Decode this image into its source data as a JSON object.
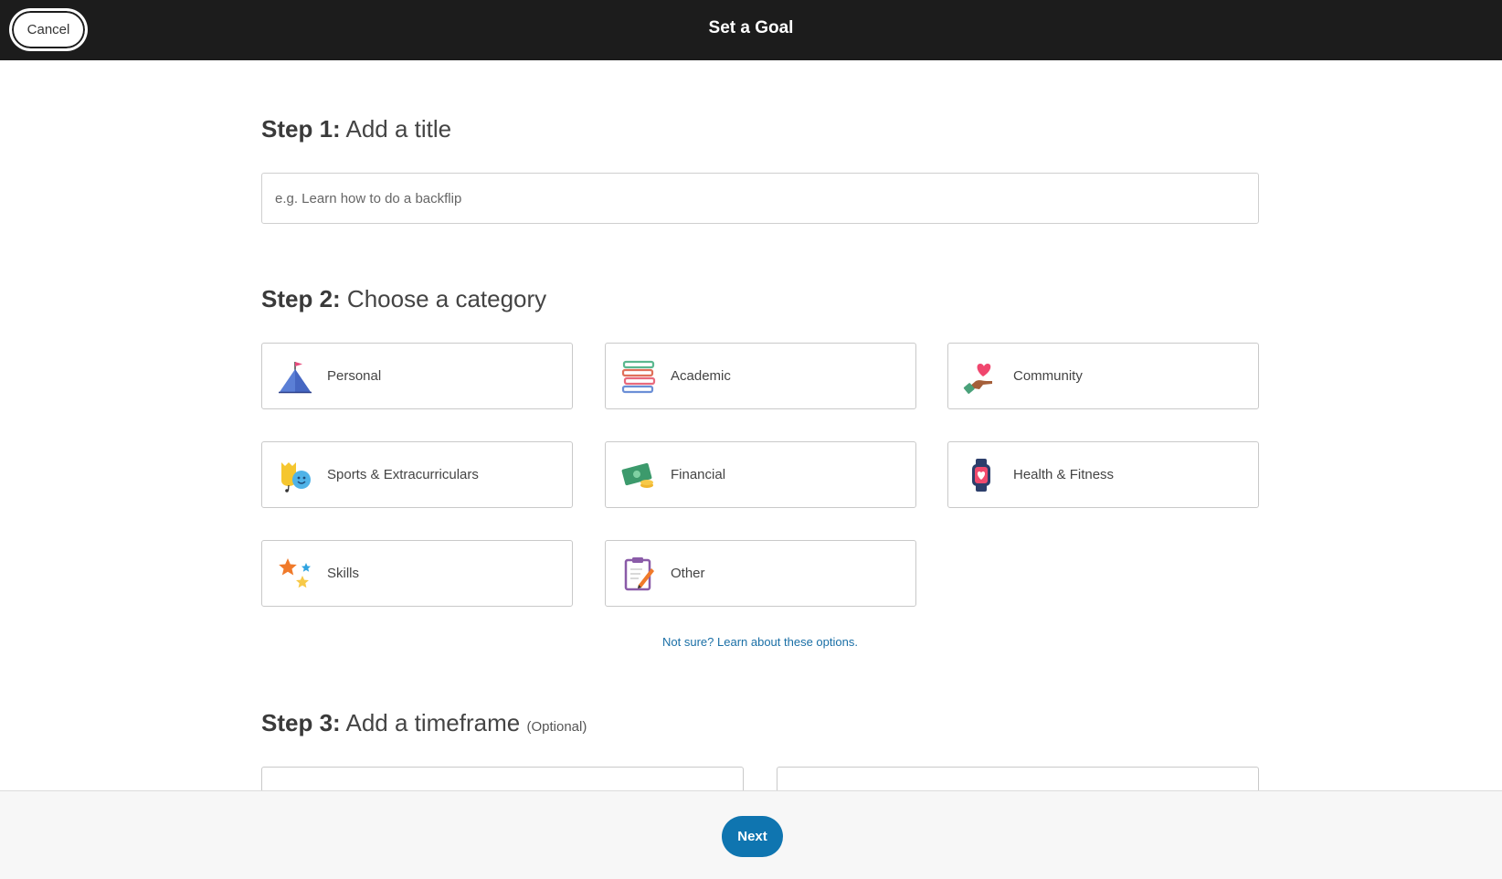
{
  "header": {
    "title": "Set a Goal",
    "cancel_label": "Cancel"
  },
  "step1": {
    "label": "Step 1:",
    "text": "Add a title",
    "placeholder": "e.g. Learn how to do a backflip"
  },
  "step2": {
    "label": "Step 2:",
    "text": "Choose a category",
    "categories": [
      {
        "label": "Personal",
        "icon": "mountain-flag-icon"
      },
      {
        "label": "Academic",
        "icon": "books-icon"
      },
      {
        "label": "Community",
        "icon": "heart-hand-icon"
      },
      {
        "label": "Sports & Extracurriculars",
        "icon": "theater-masks-icon"
      },
      {
        "label": "Financial",
        "icon": "money-icon"
      },
      {
        "label": "Health & Fitness",
        "icon": "smartwatch-heart-icon"
      },
      {
        "label": "Skills",
        "icon": "stars-icon"
      },
      {
        "label": "Other",
        "icon": "clipboard-pencil-icon"
      }
    ],
    "learn_link": "Not sure? Learn about these options."
  },
  "step3": {
    "label": "Step 3:",
    "text": "Add a timeframe",
    "optional": "(Optional)"
  },
  "footer": {
    "next_label": "Next"
  }
}
